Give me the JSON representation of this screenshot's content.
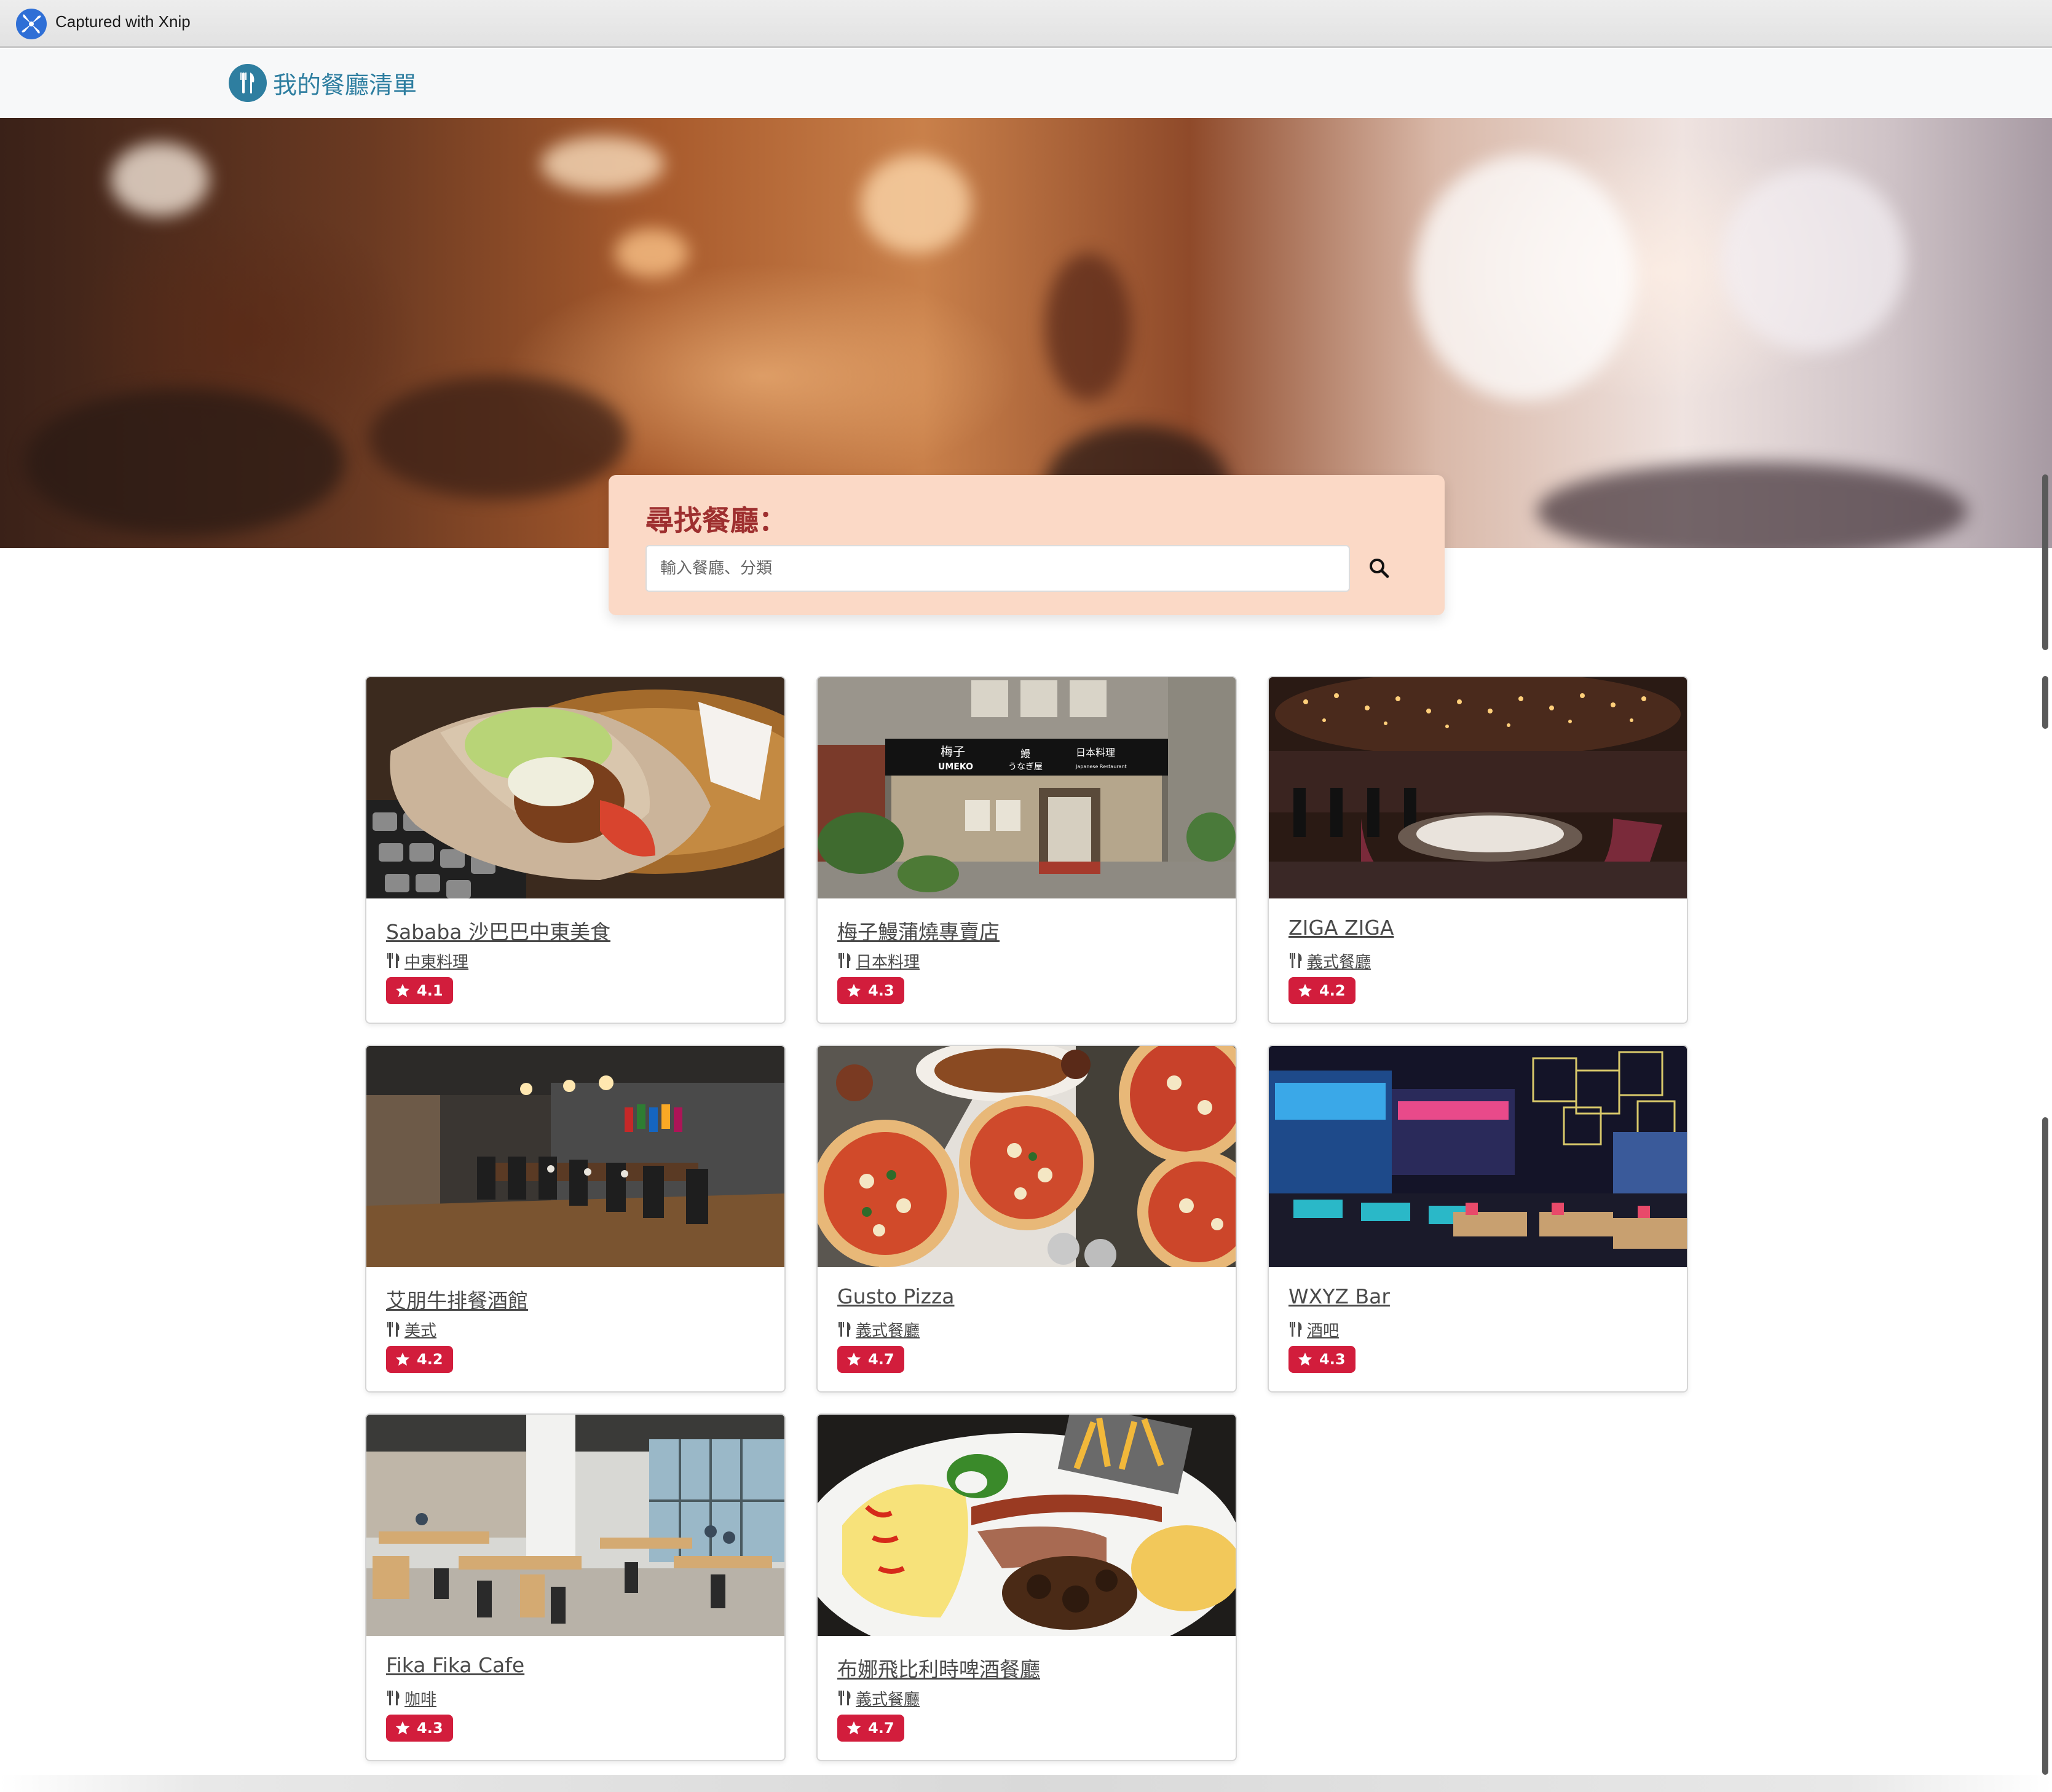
{
  "capture_bar": {
    "label": "Captured with Xnip",
    "icon": "xnip-logo-icon"
  },
  "navbar": {
    "brand_title": "我的餐廳清單",
    "brand_icon": "utensils-circle-icon",
    "brand_color": "#2e7ea0"
  },
  "search": {
    "heading": "尋找餐廳：",
    "placeholder": "輸入餐廳、分類",
    "value": "",
    "button_icon": "search-icon",
    "panel_color": "#fbd9c6",
    "heading_color": "#9e2f2f"
  },
  "restaurants": [
    {
      "name": "Sababa 沙巴巴中東美食",
      "category": "中東料理",
      "rating": "4.1"
    },
    {
      "name": "梅子鰻蒲燒專賣店",
      "category": "日本料理",
      "rating": "4.3"
    },
    {
      "name": "ZIGA ZIGA",
      "category": "義式餐廳",
      "rating": "4.2"
    },
    {
      "name": "艾朋牛排餐酒館",
      "category": "美式",
      "rating": "4.2"
    },
    {
      "name": "Gusto Pizza",
      "category": "義式餐廳",
      "rating": "4.7"
    },
    {
      "name": "WXYZ Bar",
      "category": "酒吧",
      "rating": "4.3"
    },
    {
      "name": "Fika Fika Cafe",
      "category": "咖啡",
      "rating": "4.3"
    },
    {
      "name": "布娜飛比利時啤酒餐廳",
      "category": "義式餐廳",
      "rating": "4.7"
    }
  ],
  "photo_sign": {
    "name_jp": "梅子",
    "name_en": "UMEKO",
    "eel": "鰻",
    "kana": "うなぎ屋",
    "type_jp": "日本料理",
    "type_en": "Japanese Restaurant"
  },
  "colors": {
    "rating_badge": "#d21d3c",
    "link_text": "#4a4a4a"
  }
}
